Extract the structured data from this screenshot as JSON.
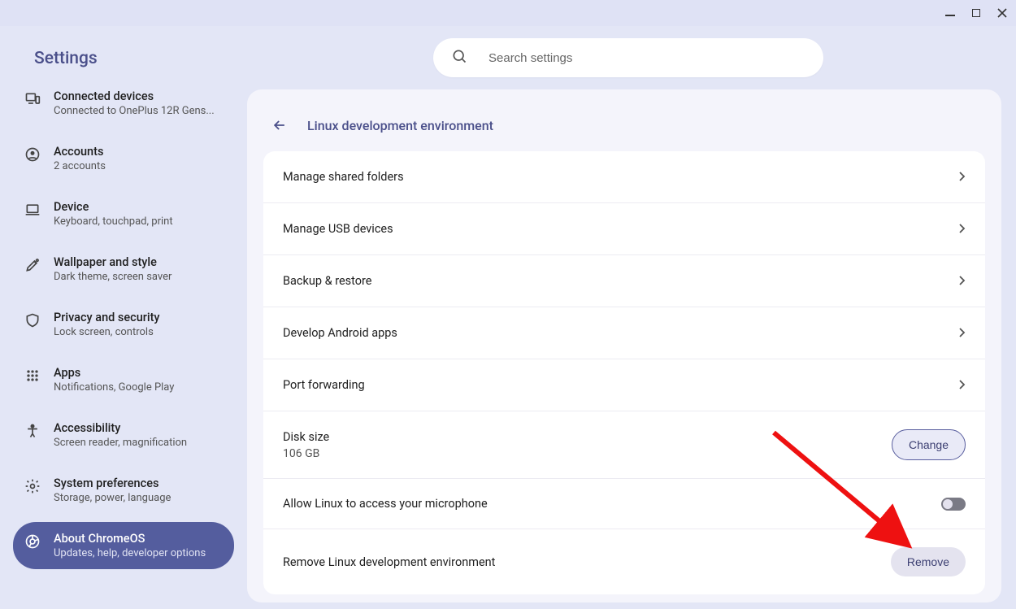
{
  "app_title": "Settings",
  "search": {
    "placeholder": "Search settings"
  },
  "sidebar": {
    "items": [
      {
        "id": "connected-devices",
        "label": "Connected devices",
        "sub": "Connected to OnePlus 12R Gens..."
      },
      {
        "id": "accounts",
        "label": "Accounts",
        "sub": "2 accounts"
      },
      {
        "id": "device",
        "label": "Device",
        "sub": "Keyboard, touchpad, print"
      },
      {
        "id": "wallpaper",
        "label": "Wallpaper and style",
        "sub": "Dark theme, screen saver"
      },
      {
        "id": "privacy",
        "label": "Privacy and security",
        "sub": "Lock screen, controls"
      },
      {
        "id": "apps",
        "label": "Apps",
        "sub": "Notifications, Google Play"
      },
      {
        "id": "accessibility",
        "label": "Accessibility",
        "sub": "Screen reader, magnification"
      },
      {
        "id": "system-prefs",
        "label": "System preferences",
        "sub": "Storage, power, language"
      },
      {
        "id": "about",
        "label": "About ChromeOS",
        "sub": "Updates, help, developer options"
      }
    ],
    "active_id": "about"
  },
  "page": {
    "title": "Linux development environment",
    "rows_nav": [
      {
        "label": "Manage shared folders"
      },
      {
        "label": "Manage USB devices"
      },
      {
        "label": "Backup & restore"
      },
      {
        "label": "Develop Android apps"
      },
      {
        "label": "Port forwarding"
      }
    ],
    "disk": {
      "label": "Disk size",
      "value": "106 GB",
      "button": "Change"
    },
    "mic": {
      "label": "Allow Linux to access your microphone",
      "enabled": false
    },
    "remove": {
      "label": "Remove Linux development environment",
      "button": "Remove"
    }
  }
}
